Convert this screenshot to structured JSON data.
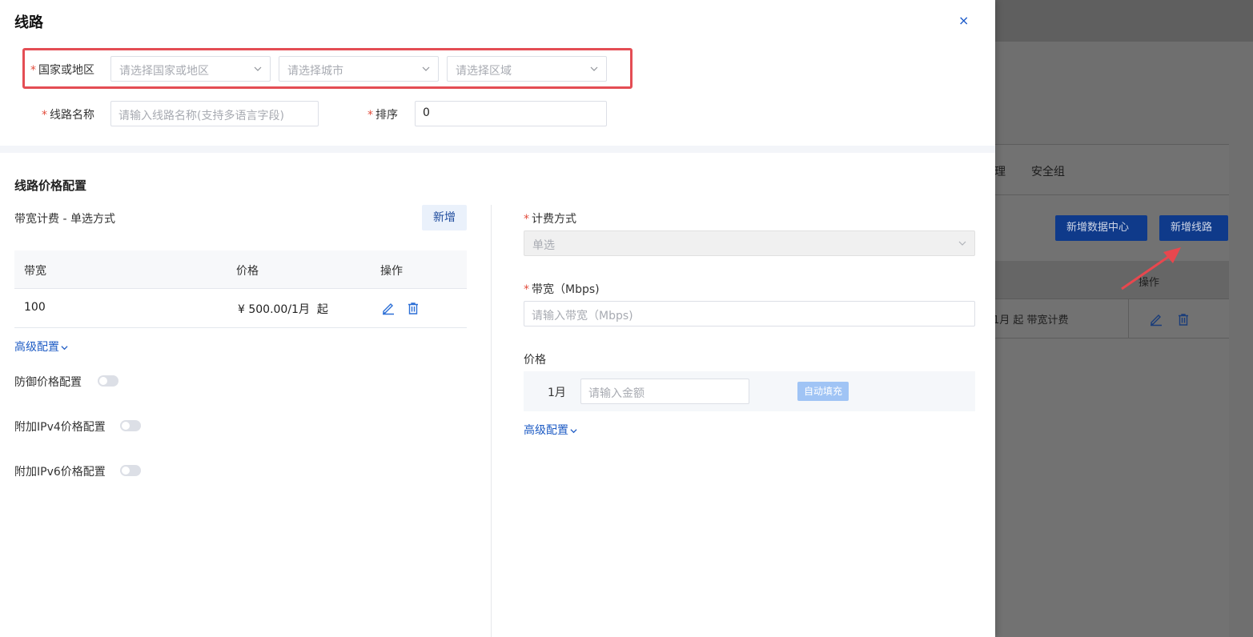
{
  "drawer": {
    "title": "线路",
    "close_label": "×"
  },
  "region": {
    "label": "国家或地区",
    "required_mark": "*",
    "country_placeholder": "请选择国家或地区",
    "city_placeholder": "请选择城市",
    "area_placeholder": "请选择区域"
  },
  "line_name": {
    "label": "线路名称",
    "required_mark": "*",
    "placeholder": "请输入线路名称(支持多语言字段)"
  },
  "sort": {
    "label": "排序",
    "required_mark": "*",
    "value": "0"
  },
  "price_config": {
    "section_title": "线路价格配置",
    "sub_title": "带宽计费 - 单选方式",
    "add_label": "新增",
    "table": {
      "headers": [
        "带宽",
        "价格",
        "操作"
      ],
      "rows": [
        {
          "bandwidth": "100",
          "price": "¥ 500.00/1月  起"
        }
      ]
    },
    "advanced_label": "高级配置",
    "defense_label": "防御价格配置",
    "ipv4_label": "附加IPv4价格配置",
    "ipv6_label": "附加IPv6价格配置"
  },
  "right_panel": {
    "billing_label": "计费方式",
    "billing_required_mark": "*",
    "billing_value": "单选",
    "bandwidth_label": "带宽（Mbps)",
    "bandwidth_required_mark": "*",
    "bandwidth_placeholder": "请输入带宽（Mbps)",
    "price_label": "价格",
    "month_label": "1月",
    "amount_placeholder": "请输入金额",
    "autofill_label": "自动填充",
    "advanced_label": "高级配置"
  },
  "background": {
    "tab_1": "理",
    "tab_2": "安全组",
    "add_datacenter_label": "新增数据中心",
    "add_line_label": "新增线路",
    "table_header_op": "操作",
    "row_text": "1月 起  带宽计费"
  }
}
